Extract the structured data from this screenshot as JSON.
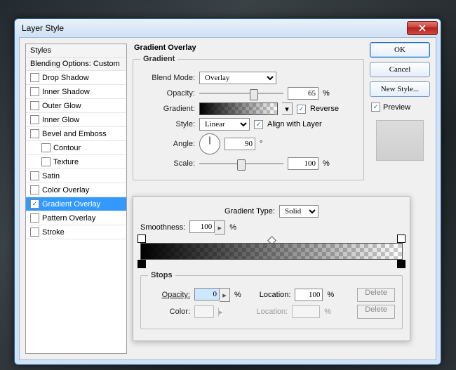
{
  "window": {
    "title": "Layer Style"
  },
  "sidebar": {
    "styles_header": "Styles",
    "blending_header": "Blending Options: Custom",
    "items": [
      {
        "label": "Drop Shadow",
        "checked": false,
        "indent": false
      },
      {
        "label": "Inner Shadow",
        "checked": false,
        "indent": false
      },
      {
        "label": "Outer Glow",
        "checked": false,
        "indent": false
      },
      {
        "label": "Inner Glow",
        "checked": false,
        "indent": false
      },
      {
        "label": "Bevel and Emboss",
        "checked": false,
        "indent": false
      },
      {
        "label": "Contour",
        "checked": false,
        "indent": true
      },
      {
        "label": "Texture",
        "checked": false,
        "indent": true
      },
      {
        "label": "Satin",
        "checked": false,
        "indent": false
      },
      {
        "label": "Color Overlay",
        "checked": false,
        "indent": false
      },
      {
        "label": "Gradient Overlay",
        "checked": true,
        "indent": false,
        "selected": true
      },
      {
        "label": "Pattern Overlay",
        "checked": false,
        "indent": false
      },
      {
        "label": "Stroke",
        "checked": false,
        "indent": false
      }
    ]
  },
  "buttons": {
    "ok": "OK",
    "cancel": "Cancel",
    "new_style": "New Style...",
    "preview_label": "Preview",
    "preview_checked": true
  },
  "panel": {
    "group_title": "Gradient Overlay",
    "subgroup_title": "Gradient",
    "blend_mode_label": "Blend Mode:",
    "blend_mode_value": "Overlay",
    "opacity_label": "Opacity:",
    "opacity_value": "65",
    "opacity_pct_pos": 65,
    "gradient_label": "Gradient:",
    "reverse_label": "Reverse",
    "reverse_checked": true,
    "style_label": "Style:",
    "style_value": "Linear",
    "align_label": "Align with Layer",
    "align_checked": true,
    "angle_label": "Angle:",
    "angle_value": "90",
    "angle_deg": "°",
    "scale_label": "Scale:",
    "scale_value": "100",
    "scale_pct_pos": 50
  },
  "editor": {
    "type_label": "Gradient Type:",
    "type_value": "Solid",
    "smoothness_label": "Smoothness:",
    "smoothness_value": "100",
    "pct": "%",
    "stops_title": "Stops",
    "opacity_label": "Opacity:",
    "opacity_value": "0",
    "location_label": "Location:",
    "location_value": "100",
    "delete_label": "Delete",
    "color_label": "Color:",
    "color_location_value": ""
  }
}
